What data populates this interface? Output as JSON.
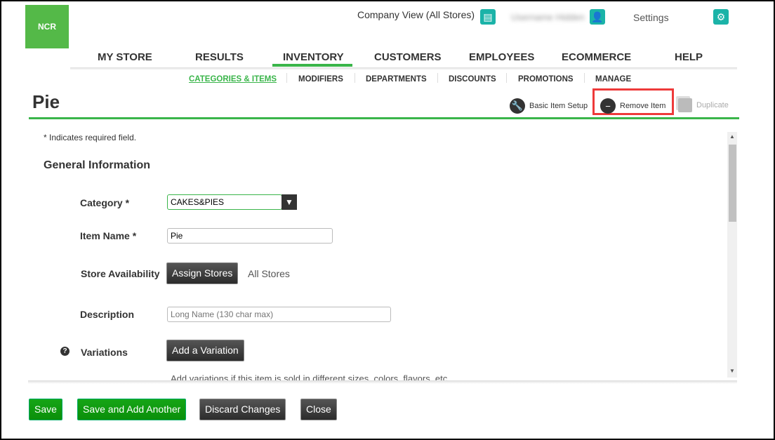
{
  "header": {
    "logo": "NCR",
    "company_view": "Company View (All Stores)",
    "user_name": "Username Hidden",
    "settings": "Settings"
  },
  "nav": {
    "items": [
      "MY STORE",
      "RESULTS",
      "INVENTORY",
      "CUSTOMERS",
      "EMPLOYEES",
      "ECOMMERCE",
      "HELP"
    ],
    "active": "INVENTORY"
  },
  "subnav": {
    "items": [
      "CATEGORIES & ITEMS",
      "MODIFIERS",
      "DEPARTMENTS",
      "DISCOUNTS",
      "PROMOTIONS",
      "MANAGE"
    ],
    "active": "CATEGORIES & ITEMS"
  },
  "page": {
    "title": "Pie",
    "actions": {
      "basic_setup": "Basic Item Setup",
      "remove": "Remove Item",
      "duplicate": "Duplicate"
    }
  },
  "form": {
    "required_note": "* Indicates required field.",
    "section": "General Information",
    "category_label": "Category *",
    "category_value": "CAKES&PIES",
    "item_name_label": "Item Name *",
    "item_name_value": "Pie",
    "store_label": "Store Availability",
    "assign_stores": "Assign Stores",
    "all_stores": "All Stores",
    "description_label": "Description",
    "description_placeholder": "Long Name (130 char max)",
    "variations_label": "Variations",
    "add_variation": "Add a Variation",
    "variations_hint": "Add variations if this item is sold in different sizes, colors, flavors, etc."
  },
  "footer": {
    "save": "Save",
    "save_add": "Save and Add Another",
    "discard": "Discard Changes",
    "close": "Close"
  },
  "colors": {
    "brand_green": "#54b948",
    "accent_teal": "#1bb3a8",
    "highlight_red": "#ee3a3a"
  }
}
